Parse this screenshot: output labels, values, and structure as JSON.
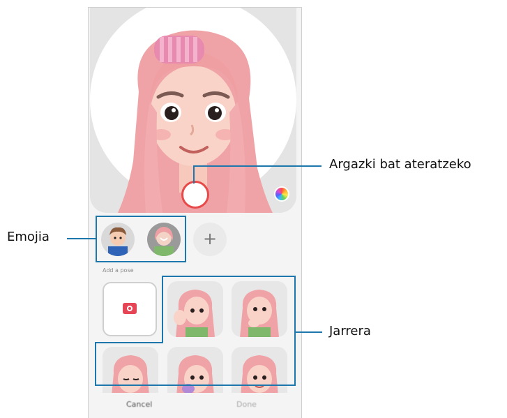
{
  "buttons": {
    "capture": "Argazki bat ateratzeko",
    "add_emoji": "+",
    "cancel": "Cancel",
    "done": "Done"
  },
  "labels": {
    "emoji_callout": "Emojia",
    "capture_callout": "Argazki bat ateratzeko",
    "poses_callout": "Jarrera"
  },
  "section": {
    "add_pose": "Add a pose"
  },
  "icons": {
    "shutter": "shutter-icon",
    "palette": "color-palette-icon",
    "camera": "camera-icon",
    "plus": "plus-icon"
  },
  "colors": {
    "callout": "#1d77ad",
    "shutter_ring": "#e84a4a",
    "camera_icon": "#e64556",
    "hair": "#f0a3a6"
  }
}
